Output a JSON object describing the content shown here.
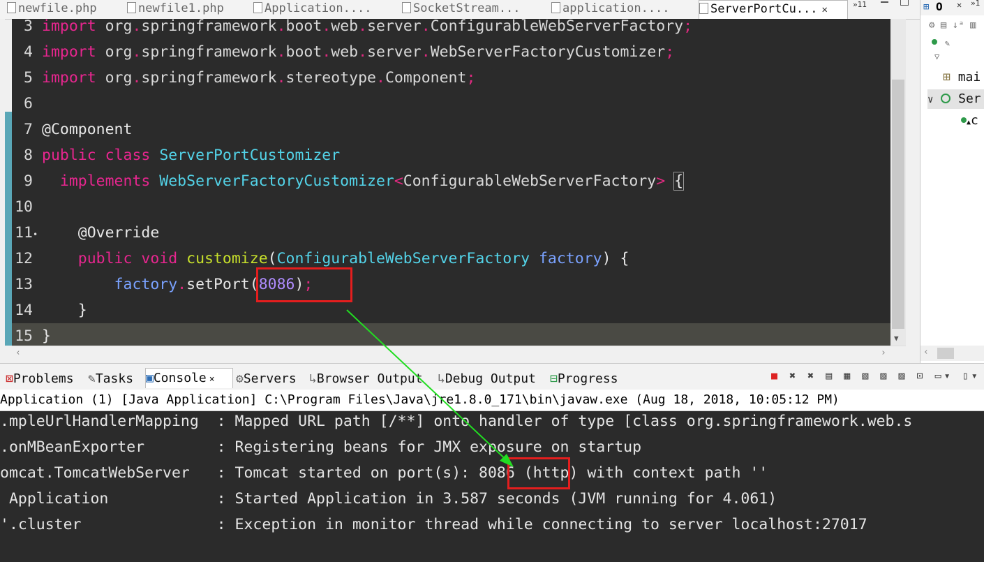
{
  "editor_tabs": [
    {
      "label": "newfile.php"
    },
    {
      "label": "newfile1.php"
    },
    {
      "label": "Application...."
    },
    {
      "label": "SocketStream..."
    },
    {
      "label": "application...."
    },
    {
      "label": "ServerPortCu...",
      "active": true
    }
  ],
  "editor_tabs_overflow": "»11",
  "code_lines": [
    {
      "n": "3",
      "parts": [
        [
          "kw",
          "import"
        ],
        [
          "pk",
          " org"
        ],
        [
          "pu",
          "."
        ],
        [
          "pk",
          "springframework"
        ],
        [
          "pu",
          "."
        ],
        [
          "pk",
          "boot"
        ],
        [
          "pu",
          "."
        ],
        [
          "pk",
          "web"
        ],
        [
          "pu",
          "."
        ],
        [
          "pk",
          "server"
        ],
        [
          "pu",
          "."
        ],
        [
          "pk",
          "ConfigurableWebServerFactory"
        ],
        [
          "pu",
          ";"
        ]
      ]
    },
    {
      "n": "4",
      "parts": [
        [
          "kw",
          "import"
        ],
        [
          "pk",
          " org"
        ],
        [
          "pu",
          "."
        ],
        [
          "pk",
          "springframework"
        ],
        [
          "pu",
          "."
        ],
        [
          "pk",
          "boot"
        ],
        [
          "pu",
          "."
        ],
        [
          "pk",
          "web"
        ],
        [
          "pu",
          "."
        ],
        [
          "pk",
          "server"
        ],
        [
          "pu",
          "."
        ],
        [
          "pk",
          "WebServerFactoryCustomizer"
        ],
        [
          "pu",
          ";"
        ]
      ]
    },
    {
      "n": "5",
      "parts": [
        [
          "kw",
          "import"
        ],
        [
          "pk",
          " org"
        ],
        [
          "pu",
          "."
        ],
        [
          "pk",
          "springframework"
        ],
        [
          "pu",
          "."
        ],
        [
          "pk",
          "stereotype"
        ],
        [
          "pu",
          "."
        ],
        [
          "pk",
          "Component"
        ],
        [
          "pu",
          ";"
        ]
      ]
    },
    {
      "n": "6",
      "parts": []
    },
    {
      "n": "7",
      "parts": [
        [
          "an",
          "@Component"
        ]
      ]
    },
    {
      "n": "8",
      "parts": [
        [
          "kw",
          "public"
        ],
        [
          "an",
          " "
        ],
        [
          "kw",
          "class"
        ],
        [
          "an",
          " "
        ],
        [
          "ty",
          "ServerPortCustomizer"
        ]
      ]
    },
    {
      "n": "9",
      "parts": [
        [
          "an",
          "  "
        ],
        [
          "kw",
          "implements"
        ],
        [
          "an",
          " "
        ],
        [
          "ty",
          "WebServerFactoryCustomizer"
        ],
        [
          "pu",
          "<"
        ],
        [
          "pk",
          "ConfigurableWebServerFactory"
        ],
        [
          "pu",
          ">"
        ],
        [
          "an",
          " "
        ],
        [
          "box",
          "{"
        ]
      ]
    },
    {
      "n": "10",
      "parts": []
    },
    {
      "n": "11",
      "marker": "•",
      "parts": [
        [
          "an",
          "    @Override"
        ]
      ]
    },
    {
      "n": "12",
      "parts": [
        [
          "an",
          "    "
        ],
        [
          "kw",
          "public"
        ],
        [
          "an",
          " "
        ],
        [
          "kw",
          "void"
        ],
        [
          "an",
          " "
        ],
        [
          "df",
          "customize"
        ],
        [
          "an",
          "("
        ],
        [
          "ty",
          "ConfigurableWebServerFactory"
        ],
        [
          "an",
          " "
        ],
        [
          "pr",
          "factory"
        ],
        [
          "an",
          ") {"
        ]
      ]
    },
    {
      "n": "13",
      "parts": [
        [
          "an",
          "        "
        ],
        [
          "pr",
          "factory"
        ],
        [
          "pu",
          "."
        ],
        [
          "an",
          "setPort("
        ],
        [
          "nu",
          "8086"
        ],
        [
          "an",
          ")"
        ],
        [
          "pu",
          ";"
        ]
      ]
    },
    {
      "n": "14",
      "parts": [
        [
          "an",
          "    }"
        ]
      ]
    },
    {
      "n": "15",
      "current": true,
      "parts": [
        [
          "an",
          "}"
        ]
      ]
    }
  ],
  "outline": {
    "tab_label": "O",
    "items": [
      "mai",
      "Ser",
      "c"
    ]
  },
  "panel_tabs": [
    {
      "label": "Problems"
    },
    {
      "label": "Tasks"
    },
    {
      "label": "Console",
      "active": true,
      "close": "×"
    },
    {
      "label": "Servers"
    },
    {
      "label": "Browser Output"
    },
    {
      "label": "Debug Output"
    },
    {
      "label": "Progress"
    }
  ],
  "console": {
    "header": "Application (1) [Java Application] C:\\Program Files\\Java\\jre1.8.0_171\\bin\\javaw.exe (Aug 18, 2018, 10:05:12 PM)",
    "lines": [
      ".mpleUrlHandlerMapping  : Mapped URL path [/**] onto handler of type [class org.springframework.web.s",
      ".onMBeanExporter        : Registering beans for JMX exposure on startup",
      "omcat.TomcatWebServer   : Tomcat started on port(s): 8086 (http) with context path ''",
      " Application            : Started Application in 3.587 seconds (JVM running for 4.061)",
      "'.cluster               : Exception in monitor thread while connecting to server localhost:27017"
    ]
  },
  "colors": {
    "highlight_box": "#e41e1e",
    "arrow": "#22dd22",
    "editor_bg": "#2b2b2b"
  }
}
